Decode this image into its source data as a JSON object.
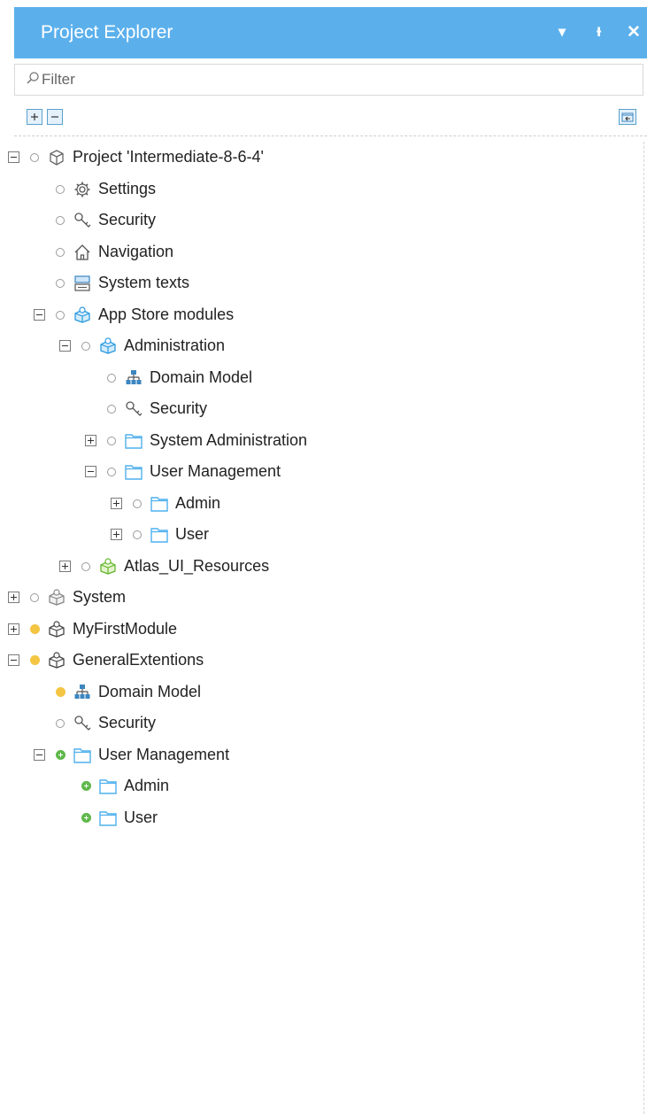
{
  "panel": {
    "title": "Project Explorer",
    "controls": {
      "dropdown": "▾",
      "pin": "ᵻ",
      "close": "✕"
    }
  },
  "filter": {
    "placeholder": "Filter",
    "value": ""
  },
  "tree": [
    {
      "label": "Project 'Intermediate-8-6-4'",
      "icon": "project-cube-icon",
      "status": "none",
      "expander": "collapse"
    },
    {
      "label": "Settings",
      "icon": "gear-icon",
      "status": "none",
      "expander": ""
    },
    {
      "label": "Security",
      "icon": "key-icon",
      "status": "none",
      "expander": ""
    },
    {
      "label": "Navigation",
      "icon": "home-icon",
      "status": "none",
      "expander": ""
    },
    {
      "label": "System texts",
      "icon": "system-texts-icon",
      "status": "none",
      "expander": ""
    },
    {
      "label": "App Store modules",
      "icon": "app-store-module-icon",
      "status": "none",
      "expander": "collapse"
    },
    {
      "label": "Administration",
      "icon": "app-store-module-icon",
      "status": "none",
      "expander": "collapse"
    },
    {
      "label": "Domain Model",
      "icon": "domain-model-icon",
      "status": "none",
      "expander": ""
    },
    {
      "label": "Security",
      "icon": "key-icon",
      "status": "none",
      "expander": ""
    },
    {
      "label": "System Administration",
      "icon": "folder-icon",
      "status": "none",
      "expander": "expand"
    },
    {
      "label": "User Management",
      "icon": "folder-icon",
      "status": "none",
      "expander": "collapse"
    },
    {
      "label": "Admin",
      "icon": "folder-icon",
      "status": "none",
      "expander": "expand"
    },
    {
      "label": "User",
      "icon": "folder-icon",
      "status": "none",
      "expander": "expand"
    },
    {
      "label": "Atlas_UI_Resources",
      "icon": "atlas-module-icon",
      "status": "none",
      "expander": "expand"
    },
    {
      "label": "System",
      "icon": "system-module-icon",
      "status": "none",
      "expander": "expand"
    },
    {
      "label": "MyFirstModule",
      "icon": "module-icon",
      "status": "yellow",
      "expander": "expand"
    },
    {
      "label": "GeneralExtentions",
      "icon": "module-icon",
      "status": "yellow",
      "expander": "collapse"
    },
    {
      "label": "Domain Model",
      "icon": "domain-model-icon",
      "status": "yellow",
      "expander": ""
    },
    {
      "label": "Security",
      "icon": "key-icon",
      "status": "none",
      "expander": ""
    },
    {
      "label": "User Management",
      "icon": "folder-icon",
      "status": "green",
      "expander": "collapse"
    },
    {
      "label": "Admin",
      "icon": "folder-icon",
      "status": "green",
      "expander": ""
    },
    {
      "label": "User",
      "icon": "folder-icon",
      "status": "green",
      "expander": ""
    }
  ]
}
